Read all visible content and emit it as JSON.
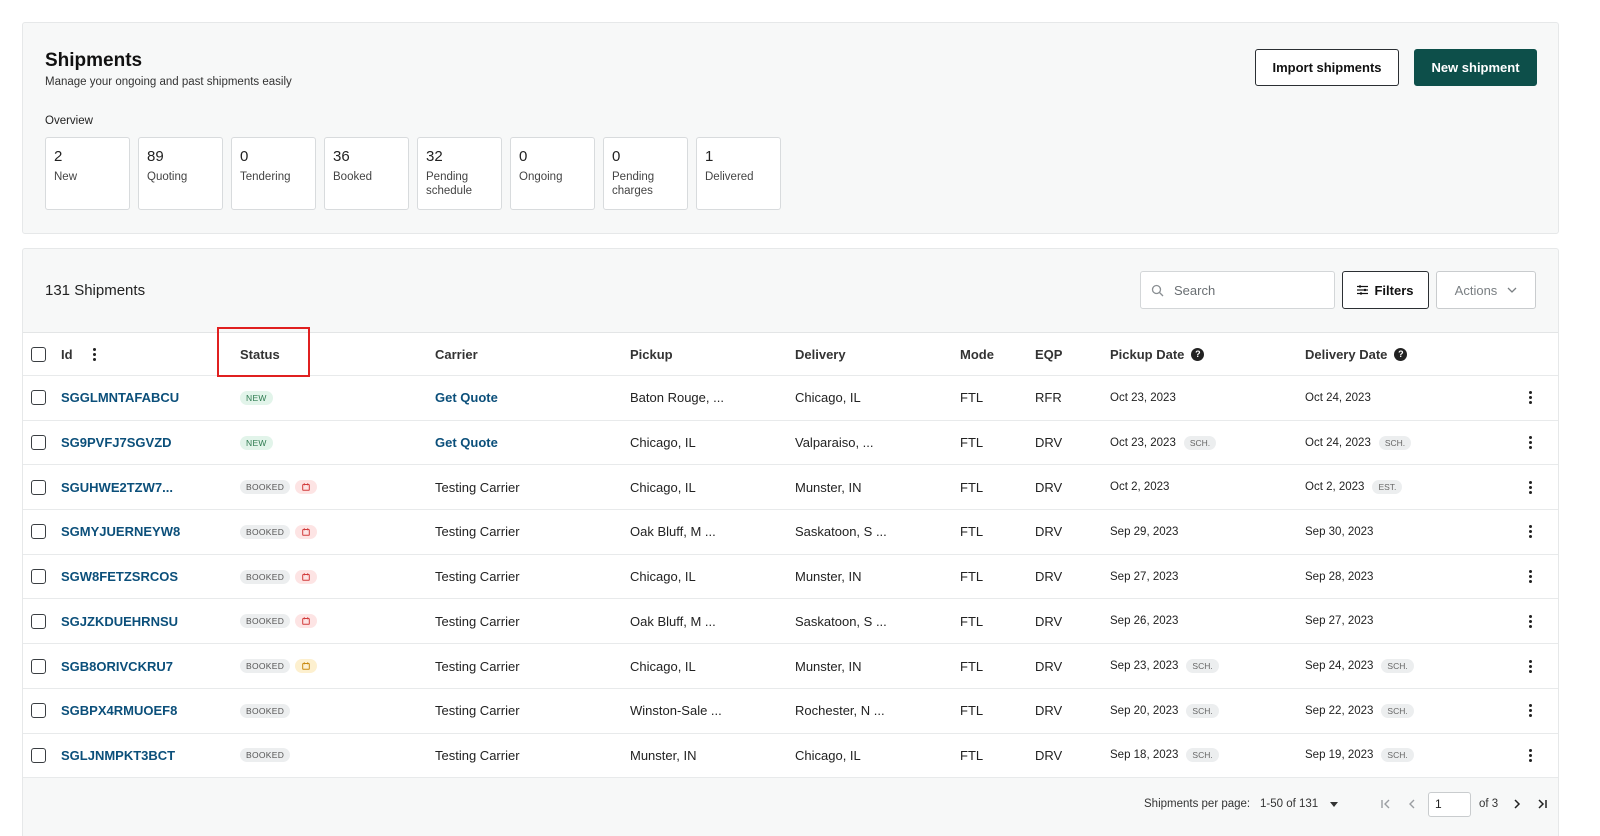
{
  "header": {
    "title": "Shipments",
    "subtitle": "Manage your ongoing and past shipments easily",
    "import_label": "Import shipments",
    "new_label": "New shipment",
    "overview_label": "Overview"
  },
  "overview": [
    {
      "value": "2",
      "label": "New"
    },
    {
      "value": "89",
      "label": "Quoting"
    },
    {
      "value": "0",
      "label": "Tendering"
    },
    {
      "value": "36",
      "label": "Booked"
    },
    {
      "value": "32",
      "label": "Pending schedule"
    },
    {
      "value": "0",
      "label": "Ongoing"
    },
    {
      "value": "0",
      "label": "Pending charges"
    },
    {
      "value": "1",
      "label": "Delivered"
    }
  ],
  "toolbar": {
    "count_label": "131 Shipments",
    "search_placeholder": "Search",
    "filters_label": "Filters",
    "actions_label": "Actions"
  },
  "table": {
    "columns": {
      "id": "Id",
      "status": "Status",
      "carrier": "Carrier",
      "pickup": "Pickup",
      "delivery": "Delivery",
      "mode": "Mode",
      "eqp": "EQP",
      "pickup_date": "Pickup Date",
      "delivery_date": "Delivery Date"
    },
    "rows": [
      {
        "id": "SGGLMNTAFABCU",
        "status": "NEW",
        "calendar": "",
        "carrier": "Get Quote",
        "carrier_link": true,
        "pickup": "Baton Rouge, ...",
        "delivery": "Chicago, IL",
        "mode": "FTL",
        "eqp": "RFR",
        "pickup_date": "Oct 23, 2023",
        "pickup_tag": "",
        "delivery_date": "Oct 24, 2023",
        "delivery_tag": ""
      },
      {
        "id": "SG9PVFJ7SGVZD",
        "status": "NEW",
        "calendar": "",
        "carrier": "Get Quote",
        "carrier_link": true,
        "pickup": "Chicago, IL",
        "delivery": "Valparaiso, ...",
        "mode": "FTL",
        "eqp": "DRV",
        "pickup_date": "Oct 23, 2023",
        "pickup_tag": "SCH.",
        "delivery_date": "Oct 24, 2023",
        "delivery_tag": "SCH."
      },
      {
        "id": "SGUHWE2TZW7...",
        "status": "BOOKED",
        "calendar": "red",
        "carrier": "Testing Carrier",
        "carrier_link": false,
        "pickup": "Chicago, IL",
        "delivery": "Munster, IN",
        "mode": "FTL",
        "eqp": "DRV",
        "pickup_date": "Oct 2, 2023",
        "pickup_tag": "",
        "delivery_date": "Oct 2, 2023",
        "delivery_tag": "EST."
      },
      {
        "id": "SGMYJUERNEYW8",
        "status": "BOOKED",
        "calendar": "red",
        "carrier": "Testing Carrier",
        "carrier_link": false,
        "pickup": "Oak Bluff, M ...",
        "delivery": "Saskatoon, S ...",
        "mode": "FTL",
        "eqp": "DRV",
        "pickup_date": "Sep 29, 2023",
        "pickup_tag": "",
        "delivery_date": "Sep 30, 2023",
        "delivery_tag": ""
      },
      {
        "id": "SGW8FETZSRCOS",
        "status": "BOOKED",
        "calendar": "red",
        "carrier": "Testing Carrier",
        "carrier_link": false,
        "pickup": "Chicago, IL",
        "delivery": "Munster, IN",
        "mode": "FTL",
        "eqp": "DRV",
        "pickup_date": "Sep 27, 2023",
        "pickup_tag": "",
        "delivery_date": "Sep 28, 2023",
        "delivery_tag": ""
      },
      {
        "id": "SGJZKDUEHRNSU",
        "status": "BOOKED",
        "calendar": "red",
        "carrier": "Testing Carrier",
        "carrier_link": false,
        "pickup": "Oak Bluff, M ...",
        "delivery": "Saskatoon, S ...",
        "mode": "FTL",
        "eqp": "DRV",
        "pickup_date": "Sep 26, 2023",
        "pickup_tag": "",
        "delivery_date": "Sep 27, 2023",
        "delivery_tag": ""
      },
      {
        "id": "SGB8ORIVCKRU7",
        "status": "BOOKED",
        "calendar": "yellow",
        "carrier": "Testing Carrier",
        "carrier_link": false,
        "pickup": "Chicago, IL",
        "delivery": "Munster, IN",
        "mode": "FTL",
        "eqp": "DRV",
        "pickup_date": "Sep 23, 2023",
        "pickup_tag": "SCH.",
        "delivery_date": "Sep 24, 2023",
        "delivery_tag": "SCH."
      },
      {
        "id": "SGBPX4RMUOEF8",
        "status": "BOOKED",
        "calendar": "",
        "carrier": "Testing Carrier",
        "carrier_link": false,
        "pickup": "Winston-Sale ...",
        "delivery": "Rochester, N ...",
        "mode": "FTL",
        "eqp": "DRV",
        "pickup_date": "Sep 20, 2023",
        "pickup_tag": "SCH.",
        "delivery_date": "Sep 22, 2023",
        "delivery_tag": "SCH."
      },
      {
        "id": "SGLJNMPKT3BCT",
        "status": "BOOKED",
        "calendar": "",
        "carrier": "Testing Carrier",
        "carrier_link": false,
        "pickup": "Munster, IN",
        "delivery": "Chicago, IL",
        "mode": "FTL",
        "eqp": "DRV",
        "pickup_date": "Sep 18, 2023",
        "pickup_tag": "SCH.",
        "delivery_date": "Sep 19, 2023",
        "delivery_tag": "SCH."
      }
    ]
  },
  "pagination": {
    "per_page_label": "Shipments per page:",
    "range": "1-50 of 131",
    "current_page": "1",
    "of_label": "of 3"
  },
  "colors": {
    "brand": "#0d4f4a",
    "link": "#0b4f7a",
    "highlight": "#e02020"
  },
  "icons": [
    "search-icon",
    "filter-icon",
    "chevron-down-icon",
    "help-icon",
    "kebab-icon",
    "calendar-icon",
    "first-page-icon",
    "prev-page-icon",
    "next-page-icon",
    "last-page-icon"
  ]
}
